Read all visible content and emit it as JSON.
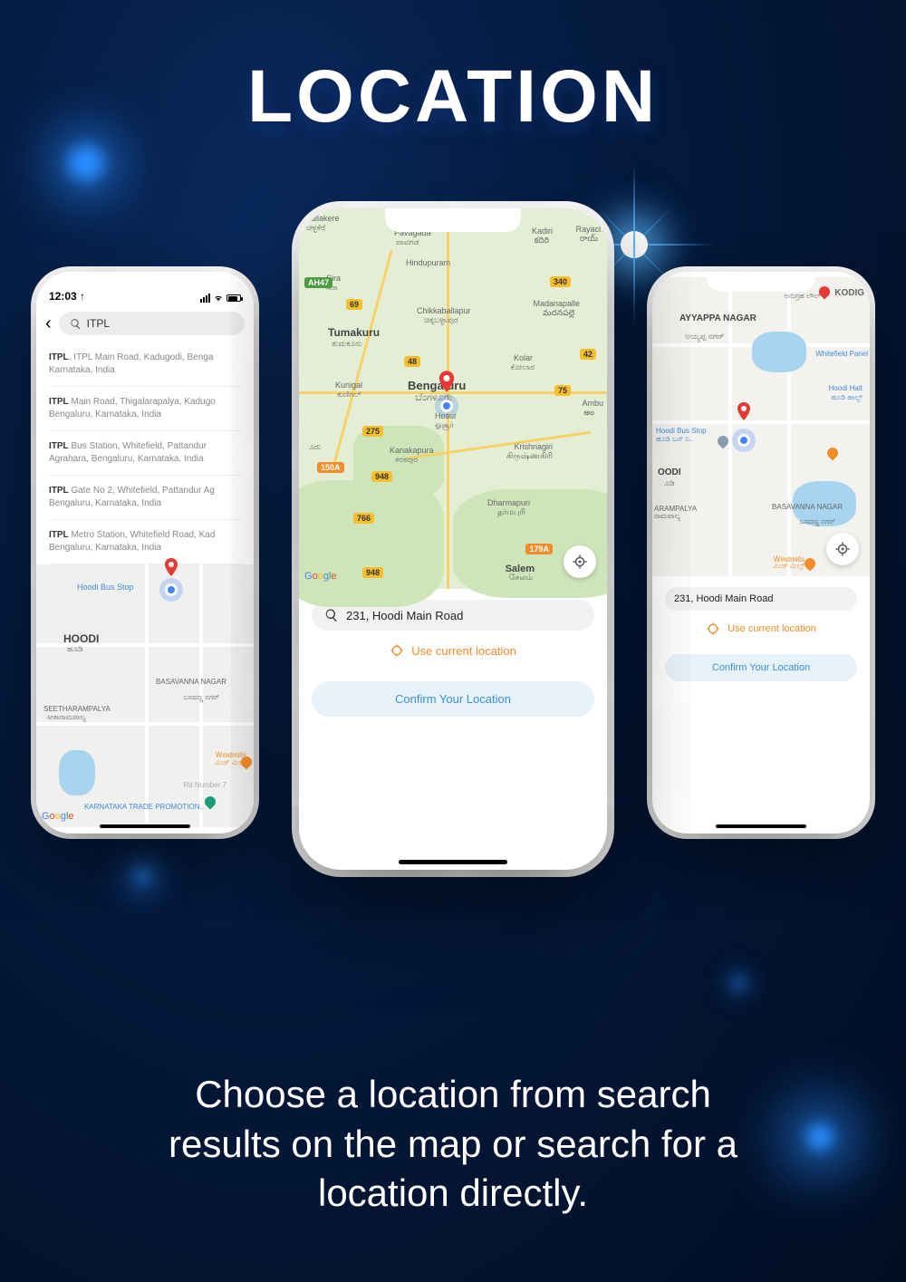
{
  "title": "LOCATION",
  "subtitle_line1": "Choose a location from search",
  "subtitle_line2": "results on the map or search for a",
  "subtitle_line3": "location directly.",
  "left_phone": {
    "time": "12:03",
    "search_value": "ITPL",
    "results": [
      {
        "bold": "ITPL",
        "rest": ", ITPL Main Road, Kadugodi, Benga",
        "line2": "Karnataka, India"
      },
      {
        "bold": "ITPL",
        "rest": " Main Road, Thigalarapalya, Kadugo",
        "line2": "Bengaluru, Karnataka, India"
      },
      {
        "bold": "ITPL",
        "rest": " Bus Station, Whitefield, Pattandur",
        "line2": "Agrahara, Bengaluru, Karnataka, India"
      },
      {
        "bold": "ITPL",
        "rest": " Gate No 2, Whitefield, Pattandur Ag",
        "line2": "Bengaluru, Karnataka, India"
      },
      {
        "bold": "ITPL",
        "rest": " Metro Station, Whitefield Road, Kad",
        "line2": "Bengaluru, Karnataka, India"
      }
    ],
    "map_labels": {
      "hoodi_bus_stop": "Hoodi Bus Stop",
      "hoodi": "HOODI",
      "hoodi_kn": "ಹೂಡಿ",
      "seetharampalya": "SEETHARAMPALYA",
      "seetharampalya_kn": "ಸೀತಾರಾಮಪಾಲ್ಯ",
      "basavanna": "BASAVANNA NAGAR",
      "basavanna_kn": "ಬಸವಣ್ಣ ನಗರ್",
      "windmills": "Windmills",
      "windmills_kn": "ವಿಂಡ್ ಮಿಲ್ಸ್",
      "road_num": "Rd Number 7",
      "karnataka_trade": "KARNATAKA TRADE PROMOTION..",
      "google": "Google"
    }
  },
  "center_phone": {
    "search_value": "231, Hoodi Main Road",
    "use_current": "Use current location",
    "confirm": "Confirm Your Location",
    "map_labels": {
      "nallakere": "nallakere",
      "nallakere_kn": "ಚಳ್ಳಕೆರೆ",
      "pavagada": "Pavagada",
      "pavagada_kn": "ಪಾವಗಡ",
      "kadiri": "Kadiri",
      "kadiri_kn": "కదిరి",
      "rayach": "Rayach",
      "rayach_kn": "రాయ్",
      "hindupuram": "Hindupuram",
      "sira": "Sira",
      "sira_kn": "ಸಿರಾ",
      "chikkaballapur": "Chikkaballapur",
      "chikkaballapur_kn": "ಚಿಕ್ಕಬಳ್ಳಾಪುರ",
      "madanapalle": "Madanapalle",
      "madanapalle_kn": "మదనపల్లె",
      "tumakuru": "Tumakuru",
      "tumakuru_kn": "ತುಮಕೂರು",
      "kolar": "Kolar",
      "kolar_kn": "ಕೋಲಾರ",
      "kunigal": "Kunigal",
      "kunigal_kn": "ಕುಣಿಗಲ್",
      "bengaluru": "Bengaluru",
      "bengaluru_kn": "ಬೆಂಗಳೂರು",
      "hosur": "Hosur",
      "hosur_kn": "ஓசூர்",
      "ambu": "Ambu",
      "ambu_kn": "అం",
      "uru_kn": "ೂರು",
      "kanakapura": "Kanakapura",
      "kanakapura_kn": "ಕನಕಪುರ",
      "krishnagiri": "Krishnagiri",
      "krishnagiri_kn": "கிருஷ்ணகிரி",
      "dharmapuri": "Dharmapuri",
      "dharmapuri_kn": "தர்மபுரி",
      "salem": "Salem",
      "salem_kn": "சேலம்",
      "google": "Google"
    },
    "shields": {
      "ah47": "AH47",
      "s69": "69",
      "s48": "48",
      "s75": "75",
      "s42": "42",
      "s340": "340",
      "s948": "948",
      "s275": "275",
      "s150a": "150A",
      "s766": "766",
      "s179a": "179A",
      "s948b": "948"
    }
  },
  "right_phone": {
    "search_value": "231, Hoodi Main Road",
    "use_current": "Use current location",
    "confirm": "Confirm Your Location",
    "map_labels": {
      "kodig": "KODIG",
      "kodig_kn": "ಅನುಗ್ರಹ ಲೌಲ್",
      "ayyappa": "AYYAPPA NAGAR",
      "ayyappa_kn": "ಅಯ್ಯಪ್ಪ ನಗರ್",
      "whitefield": "Whitefield Panel",
      "hoodi_halt": "Hoodi Halt",
      "hoodi_halt_kn": "ಹೂಡಿ ಹಾಲ್ಟ್",
      "hoodi_bus": "Hoodi Bus Stop",
      "hoodi_bus_kn": "ಹೂಡಿ ಬಸ್ ನಿ..",
      "oodi": "OODI",
      "oodi_kn": "ೂಡಿ",
      "basavanna": "BASAVANNA NAGAR",
      "basavanna_kn": "ಬಸವಣ್ಣ ನಗರ್",
      "arampalya": "ARAMPALYA",
      "arampalya_kn": "ರಾಮಪಾಲ್ಯ",
      "windmills": "Windmills",
      "windmills_kn": "ವಿಂಡ್ ಮಿಲ್ಸ್"
    }
  }
}
